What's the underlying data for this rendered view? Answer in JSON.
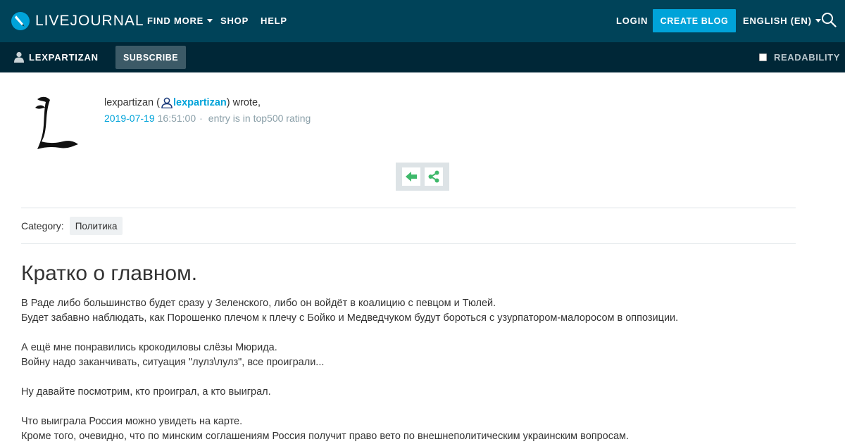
{
  "header": {
    "logo_text": "LIVEJOURNAL",
    "nav": {
      "find_more": "FIND MORE",
      "shop": "SHOP",
      "help": "HELP"
    },
    "login": "LOGIN",
    "create_blog": "CREATE BLOG",
    "language": "ENGLISH (EN)",
    "search_icon": "search-icon"
  },
  "subbar": {
    "username": "LEXPARTIZAN",
    "subscribe": "SUBSCRIBE",
    "readability": "READABILITY",
    "readability_checked": false
  },
  "entry": {
    "author_text": "lexpartizan",
    "author_link": "lexpartizan",
    "wrote": "wrote,",
    "date": "2019-07-19",
    "time": "16:51:00",
    "separator": "·",
    "rating_note": "entry is in top500 rating",
    "category_label": "Category:",
    "category": "Политика",
    "title": "Кратко о главном.",
    "body": [
      "В Раде либо большинство будет сразу у Зеленского, либо он войдёт в коалицию с певцом и Тюлей.",
      "Будет забавно наблюдать, как Порошенко плечом к плечу с Бойко и Медведчуком будут бороться с узурпатором-малоросом в оппозиции.",
      "",
      "А ещё мне понравились крокодиловы слёзы Мюрида.",
      "Войну надо заканчивать, ситуация \"лулз\\лулз\", все проиграли...",
      "",
      "Ну давайте посмотрим, кто проиграл, а кто выиграл.",
      "",
      "Что выиграла Россия можно увидеть на карте.",
      "Кроме того, очевидно, что по минским соглашениям Россия получит право вето по внешнеполитическим украинским вопросам."
    ]
  },
  "colors": {
    "topbar": "#004359",
    "subbar": "#002737",
    "accent": "#00a3d9",
    "share_green": "#3fb96b"
  }
}
